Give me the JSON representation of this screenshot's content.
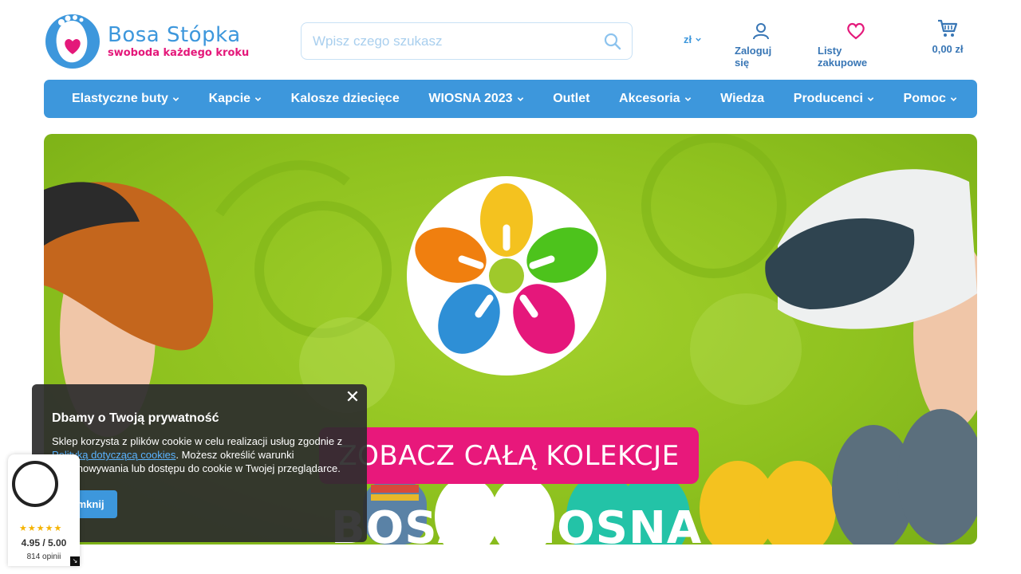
{
  "brand": {
    "name": "Bosa Stópka",
    "tagline": "swoboda każdego kroku",
    "primary_color": "#3d97dc",
    "accent_color": "#e4187a"
  },
  "search": {
    "placeholder": "Wpisz czego szukasz",
    "value": "",
    "icon": "search-icon"
  },
  "header": {
    "currency": "zł",
    "login_label": "Zaloguj się",
    "wishlist_label": "Listy zakupowe",
    "cart_total": "0,00 zł"
  },
  "nav": {
    "items": [
      {
        "label": "Elastyczne buty",
        "has_dropdown": true
      },
      {
        "label": "Kapcie",
        "has_dropdown": true
      },
      {
        "label": "Kalosze dziecięce",
        "has_dropdown": false
      },
      {
        "label": "WIOSNA 2023",
        "has_dropdown": true
      },
      {
        "label": "Outlet",
        "has_dropdown": false
      },
      {
        "label": "Akcesoria",
        "has_dropdown": true
      },
      {
        "label": "Wiedza",
        "has_dropdown": false
      },
      {
        "label": "Producenci",
        "has_dropdown": true
      },
      {
        "label": "Pomoc",
        "has_dropdown": true
      }
    ]
  },
  "banner": {
    "title": "BOSA WIOSNA",
    "cta": "ZOBACZ CAŁĄ KOLEKCJE",
    "background_color": "#8fc21f",
    "cta_color": "#e8187b"
  },
  "cookie": {
    "title": "Dbamy o Twoją prywatność",
    "text_before": "Sklep korzysta z plików cookie w celu realizacji usług zgodnie z ",
    "link_text": "Polityką dotyczącą cookies",
    "text_after": ". Możesz określić warunki przechowywania lub dostępu do cookie w Twojej przeglądarce.",
    "button_label": "Zamknij",
    "close_symbol": "✕"
  },
  "rating": {
    "stars": "★★★★★",
    "score": "4.95 / 5.00",
    "reviews": "814 opinii",
    "expand_symbol": "↘"
  }
}
